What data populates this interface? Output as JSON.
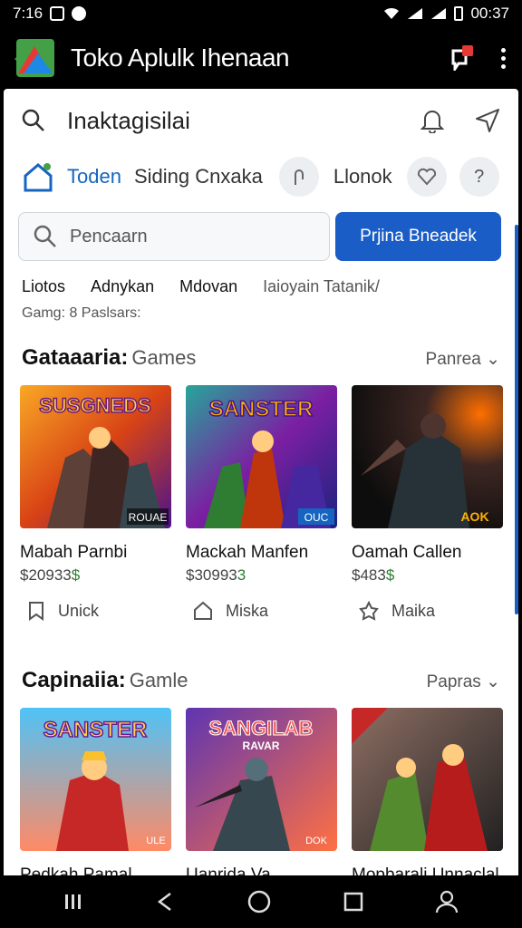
{
  "status_bar": {
    "time_left": "7:16",
    "time_right": "00:37"
  },
  "app_bar": {
    "title": "Toko Aplulk Ihenaan"
  },
  "top_search": {
    "query": "Inaktagisilai"
  },
  "category_row": {
    "home_label": "Toden",
    "second_label": "Siding Cnxaka",
    "third_label": "Llonok"
  },
  "search": {
    "placeholder": "Pencaarn",
    "button_label": "Prjina Bneadek"
  },
  "filters": [
    "Liotos",
    "Adnykan",
    "Mdovan",
    "Iaioyain Tatanik/"
  ],
  "subnote": "Gamg: 8 Paslsars:",
  "sections": [
    {
      "title_bold": "Gataaaria:",
      "title_light": "Games",
      "more_label": "Panrea",
      "cards": [
        {
          "name": "Mabah Parnbi",
          "price_a": "$20933",
          "price_b": "$",
          "meta": "Unick",
          "banner": "SUSGNEDS",
          "corner": "ROUAE"
        },
        {
          "name": "Mackah Manfen",
          "price_a": "$30993",
          "price_b": "3",
          "meta": "Miska",
          "banner": "SANSTER",
          "corner": "OUC"
        },
        {
          "name": "Oamah Callen",
          "price_a": "$483",
          "price_b": "$",
          "meta": "Maika",
          "banner": "",
          "corner": "AOK"
        }
      ]
    },
    {
      "title_bold": "Capinaiia:",
      "title_light": "Gamle",
      "more_label": "Papras",
      "cards": [
        {
          "name": "Pedkah Pamal",
          "banner": "SANSTER",
          "corner": "ULE"
        },
        {
          "name": "Uanrida Va",
          "banner": "SANGILAB",
          "sub": "RAVAR",
          "corner": "DOK"
        },
        {
          "name": "Mopbarali Unnaclal",
          "banner": "",
          "corner": ""
        }
      ]
    }
  ],
  "colors": {
    "accent": "#1a5dc6",
    "price_green": "#2e7d32",
    "bar": "#000000"
  }
}
